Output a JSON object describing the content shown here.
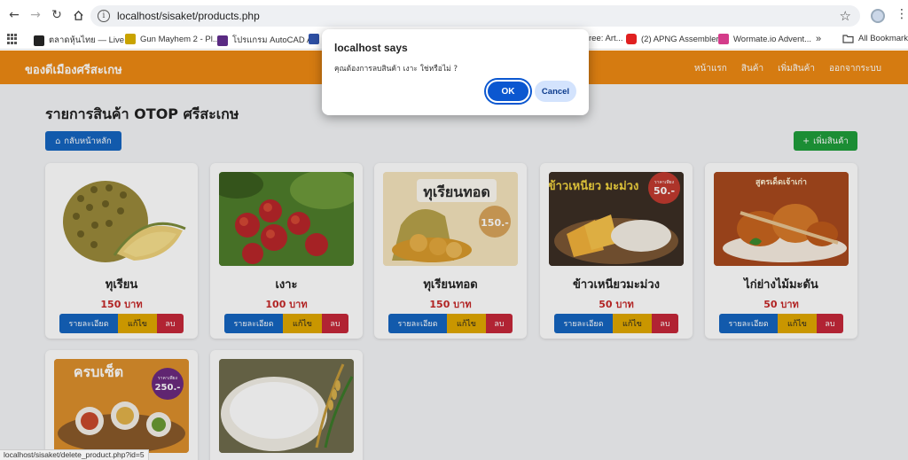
{
  "browser": {
    "url": "localhost/sisaket/products.php",
    "bookmarks": [
      {
        "label": "ตลาดหุ้นไทย — Live...",
        "color": "#222222"
      },
      {
        "label": "Gun Mayhem 2 - Pl...",
        "color": "#c9a300"
      },
      {
        "label": "โปรแกรม AutoCAD A...",
        "color": "#5a2a82"
      },
      {
        "label": "",
        "color": "#2d4fa3"
      },
      {
        "label": "ree: Art...",
        "color": ""
      },
      {
        "label": "(2) APNG Assembler...",
        "color": "#e02020"
      },
      {
        "label": "Wormate.io Advent...",
        "color": "#d43c8a"
      }
    ],
    "more_label": "»",
    "all_bookmarks_label": "All Bookmarks"
  },
  "site": {
    "brand": "ของดีเมืองศรีสะเกษ",
    "nav": [
      "หน้าแรก",
      "สินค้า",
      "เพิ่มสินค้า",
      "ออกจากระบบ"
    ],
    "page_title": "รายการสินค้า OTOP ศรีสะเกษ",
    "back_button": "กลับหน้าหลัก",
    "add_button": "เพิ่มสินค้า"
  },
  "products": [
    {
      "name": "ทุเรียน",
      "price": "150 บาท"
    },
    {
      "name": "เงาะ",
      "price": "100 บาท"
    },
    {
      "name": "ทุเรียนทอด",
      "price": "150 บาท"
    },
    {
      "name": "ข้าวเหนียวมะม่วง",
      "price": "50 บาท"
    },
    {
      "name": "ไก่ย่างไม้มะดัน",
      "price": "50 บาท"
    },
    {
      "name": "",
      "price": ""
    },
    {
      "name": "",
      "price": ""
    }
  ],
  "card_buttons": {
    "detail": "รายละเอียด",
    "edit": "แก้ไข",
    "delete": "ลบ"
  },
  "image_text": {
    "tourian_fried_title": "ทุเรียนทอด",
    "tourian_fried_price": "150.-",
    "mango_title": "ข้าวเหนียว มะม่วง",
    "mango_badge_top": "ราคาเพียง",
    "mango_badge_price": "50.-",
    "chicken_text": "สูตรเด็ดเจ้าเก่า",
    "set_title": "ครบเซ็ต",
    "set_badge_top": "ราคาเพียง",
    "set_badge_price": "250.-"
  },
  "dialog": {
    "title": "localhost says",
    "message": "คุณต้องการลบสินค้า เงาะ ใช่หรือไม่ ?",
    "ok_label": "OK",
    "cancel_label": "Cancel"
  },
  "status_url": "localhost/sisaket/delete_product.php?id=5"
}
